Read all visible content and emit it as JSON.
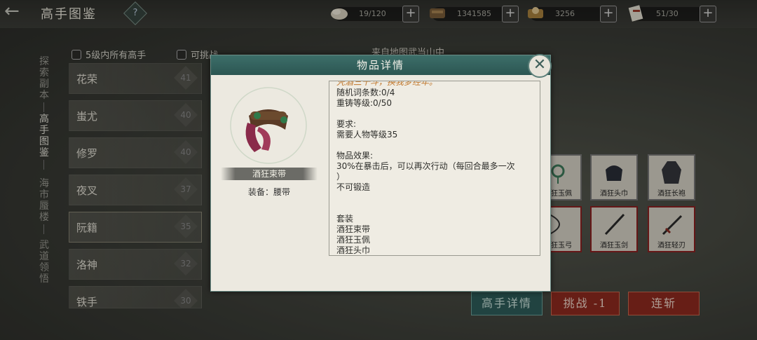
{
  "header": {
    "title": "高手图鉴",
    "help_label": "?"
  },
  "resources": [
    {
      "icon": "coin-stack-icon",
      "value": "19/120"
    },
    {
      "icon": "silver-ingot-icon",
      "value": "1341585"
    },
    {
      "icon": "gold-ingot-icon",
      "value": "3256"
    },
    {
      "icon": "scroll-ticket-icon",
      "value": "51/30"
    }
  ],
  "side_nav": [
    {
      "label": "探索副本",
      "active": false
    },
    {
      "label": "高手图鉴",
      "active": true
    },
    {
      "label": "海市蜃楼",
      "active": false
    },
    {
      "label": "武道领悟",
      "active": false
    }
  ],
  "filters": {
    "within_5": "5级内所有高手",
    "challengeable": "可挑战"
  },
  "location_note": "来自地图武当山中",
  "masters": [
    {
      "name": "花荣",
      "level": "41"
    },
    {
      "name": "蚩尤",
      "level": "40"
    },
    {
      "name": "修罗",
      "level": "40"
    },
    {
      "name": "夜叉",
      "level": "37"
    },
    {
      "name": "阮籍",
      "level": "35"
    },
    {
      "name": "洛神",
      "level": "32"
    },
    {
      "name": "铁手",
      "level": "30"
    }
  ],
  "drops": [
    {
      "name": "酒狂玉佩",
      "icon": "jade-pendant-icon",
      "rare": false
    },
    {
      "name": "酒狂头巾",
      "icon": "headscarf-icon",
      "rare": false
    },
    {
      "name": "酒狂长袍",
      "icon": "robe-icon",
      "rare": false
    },
    {
      "name": "酒狂玉弓",
      "icon": "bow-icon",
      "rare": true
    },
    {
      "name": "酒狂玉剑",
      "icon": "sword-icon",
      "rare": true
    },
    {
      "name": "酒狂轻刃",
      "icon": "blade-icon",
      "rare": true
    }
  ],
  "buttons": {
    "details": "高手详情",
    "challenge": "挑战 -1",
    "sweep": "连斩"
  },
  "modal": {
    "title": "物品详情",
    "item_name": "酒狂束带",
    "equip_slot": "装备：腰带",
    "flavor": "凭酒三千斗，换我梦经年。",
    "random_affixes": "随机词条数:0/4",
    "reforge_level": "重铸等级:0/50",
    "requirement_header": "要求:",
    "requirement": "需要人物等级35",
    "effect_header": "物品效果:",
    "effect_line1": "30%在暴击后，可以再次行动（每回合最多一次",
    "effect_line2": "）",
    "effect_line3": "不可锻造",
    "set_header": "套装",
    "set_items": [
      "酒狂束带",
      "酒狂玉佩",
      "酒狂头巾"
    ]
  },
  "colors": {
    "modal_header": "#2c5652",
    "flavor_text": "#c0762a",
    "red_button": "#8f2a1f",
    "teal_button": "#2f5e5a"
  }
}
